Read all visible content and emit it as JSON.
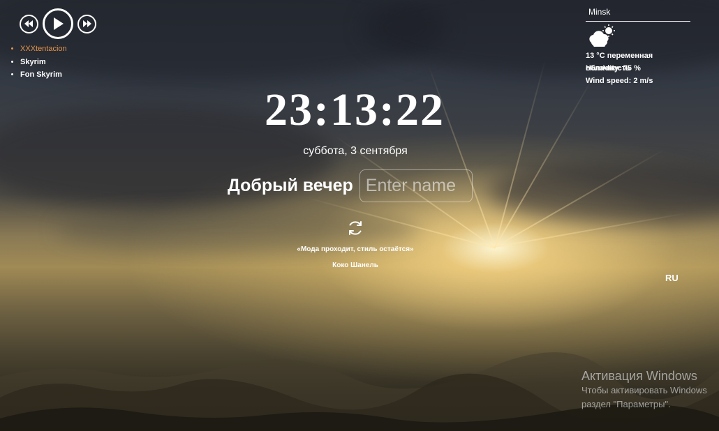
{
  "player": {
    "prev_icon": "rewind-icon",
    "play_icon": "play-icon",
    "next_icon": "fast-forward-icon",
    "tracks": [
      {
        "title": "XXXtentacion",
        "active": true
      },
      {
        "title": "Skyrim",
        "active": false
      },
      {
        "title": "Fon Skyrim",
        "active": false
      }
    ]
  },
  "weather": {
    "city": "Minsk",
    "icon": "cloudy-night-icon",
    "temp_desc": "13 °C переменная облачность",
    "humidity": "Humidity: 75 %",
    "wind": "Wind speed: 2 m/s"
  },
  "clock": {
    "time": "23:13:22",
    "date": "суббота, 3 сентября"
  },
  "greeting": {
    "text": "Добрый вечер",
    "name_placeholder": "Enter name",
    "name_value": ""
  },
  "quote": {
    "refresh_icon": "refresh-icon",
    "text": "«Мода проходит, стиль остаётся»",
    "author": "Коко Шанель"
  },
  "language": "RU",
  "activation": {
    "title": "Активация Windows",
    "line1": "Чтобы активировать Windows",
    "line2": "раздел \"Параметры\"."
  },
  "colors": {
    "active_track": "#e8954a",
    "text": "#ffffff"
  }
}
